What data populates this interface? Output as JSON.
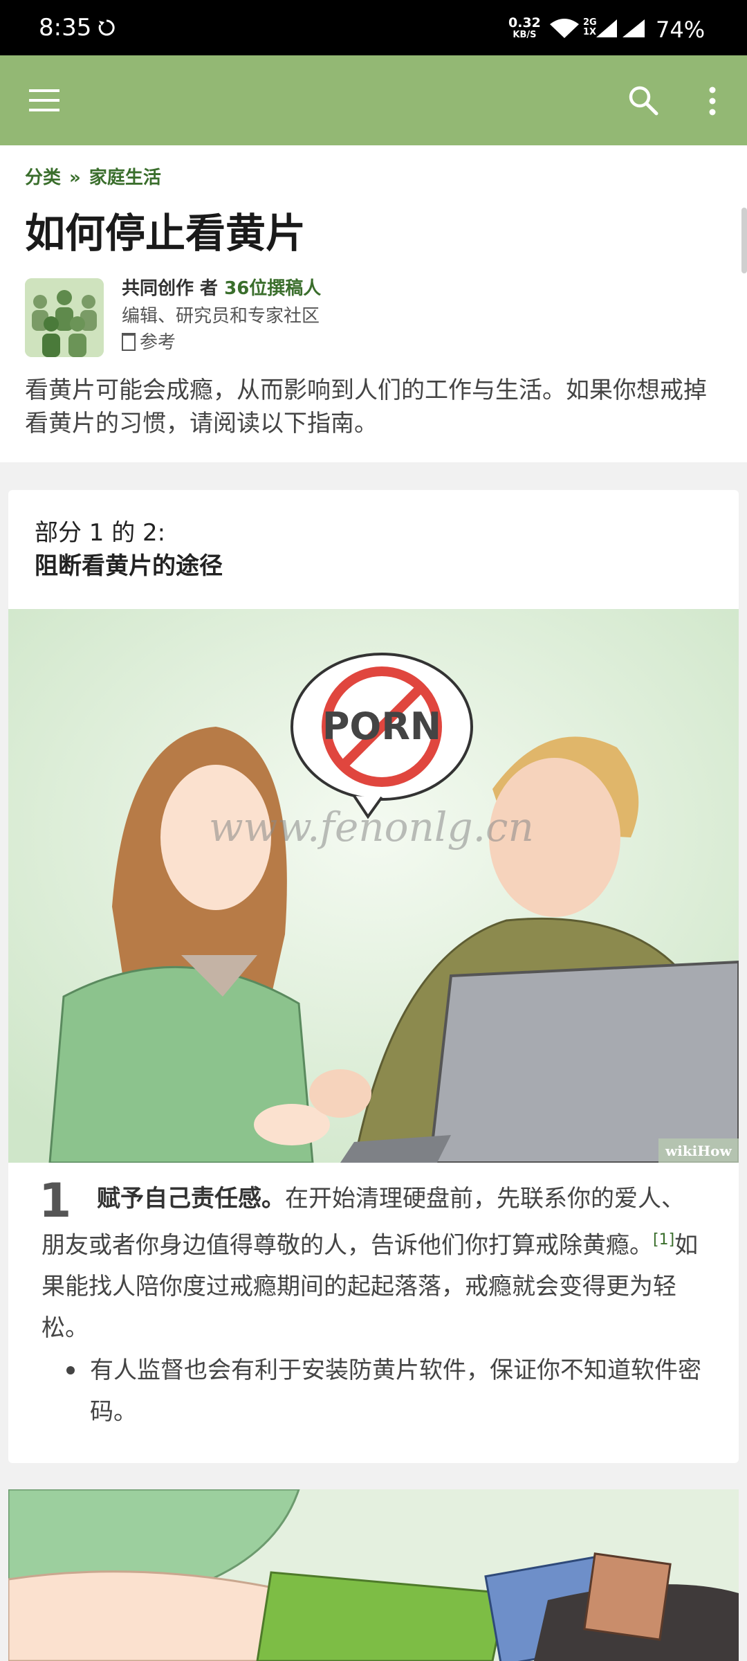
{
  "status_bar": {
    "time": "8:35",
    "net_speed": "0.32",
    "net_speed_unit": "KB/S",
    "network_type_top": "2G",
    "network_type_bottom": "1X",
    "battery": "74%"
  },
  "appbar": {
    "bg_color": "#93b874",
    "icons": [
      "menu-icon",
      "search-icon",
      "more-vert-icon"
    ]
  },
  "breadcrumb": {
    "first": "分类",
    "separator": "»",
    "second": "家庭生活"
  },
  "article": {
    "title": "如何停止看黄片",
    "author_prefix": "共同创作 者",
    "contributors": "36位撰稿人",
    "author_sub": "编辑、研究员和专家社区",
    "references": "参考",
    "intro": "看黄片可能会成瘾，从而影响到人们的工作与生活。如果你想戒掉看黄片的习惯，请阅读以下指南。"
  },
  "section": {
    "part_label": "部分 1 的 2:",
    "part_title": "阻断看黄片的途径",
    "image_sign": "PORN",
    "image_watermark": "www.fenonlg.cn",
    "image_credit": "wikiHow",
    "step_number": "1",
    "step_bold": "赋予自己责任感。",
    "step_text_a": "在开始清理硬盘前，先联系你的爱人、朋友或者你身边值得尊敬的人，告诉他们你打算戒除黄瘾。",
    "step_ref": "[1]",
    "step_text_b": "如果能找人陪你度过戒瘾期间的起起落落，戒瘾就会变得更为轻松。",
    "bullet": "有人监督也会有利于安装防黄片软件，保证你不知道软件密码。"
  }
}
